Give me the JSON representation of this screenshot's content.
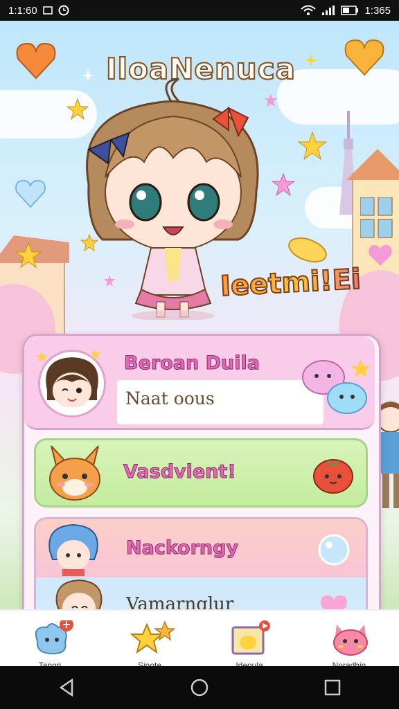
{
  "status_bar": {
    "left_time": "1:1:60",
    "right_time": "1:365"
  },
  "game": {
    "title": "IloaNenuca",
    "subtitle": "Ieetmi!Ei"
  },
  "profile": {
    "name": "Beroan Duila",
    "status": "Naat oous"
  },
  "menu": {
    "green_card_label": "Vasdvient!",
    "card_three_label": "Nackorngy",
    "card_four_label": "Vamarnglur"
  },
  "bottom_nav": {
    "items": [
      {
        "label": "Tanori",
        "icon": "blue-creature-icon",
        "badge": "notification"
      },
      {
        "label": "Sinote",
        "icon": "star-icon",
        "badge": ""
      },
      {
        "label": "Ideoula",
        "icon": "video-icon",
        "badge": "play"
      },
      {
        "label": "Noradhin",
        "icon": "pink-creature-icon",
        "badge": ""
      }
    ]
  },
  "colors": {
    "accent_pink": "#e268b6",
    "panel_border": "#d9a3cc",
    "green_card": "#c4ec9e"
  }
}
